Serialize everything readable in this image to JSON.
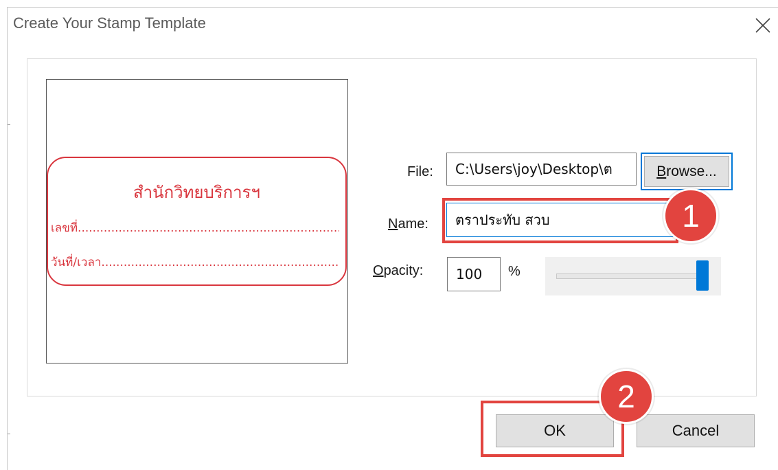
{
  "dialog": {
    "title": "Create Your Stamp Template",
    "close_icon": "close-icon"
  },
  "preview": {
    "stamp_color": "#d9363e",
    "stamp_title": "สำนักวิทยบริการฯ",
    "line1": "เลขที่.............................................................................",
    "line2": "วันที่/เวลา......................................................................"
  },
  "form": {
    "file_label": "File:",
    "file_value": "C:\\Users\\joy\\Desktop\\ต",
    "browse_label": "Browse...",
    "name_label": "Name:",
    "name_value": "ตราประทับ สวบ",
    "opacity_label": "Opacity:",
    "opacity_value": "100",
    "percent_sign": "%",
    "opacity_slider_level": 1.0
  },
  "buttons": {
    "ok_label": "OK",
    "cancel_label": "Cancel"
  },
  "annotations": {
    "color": "#e2443f",
    "badge1": "1",
    "badge2": "2"
  }
}
